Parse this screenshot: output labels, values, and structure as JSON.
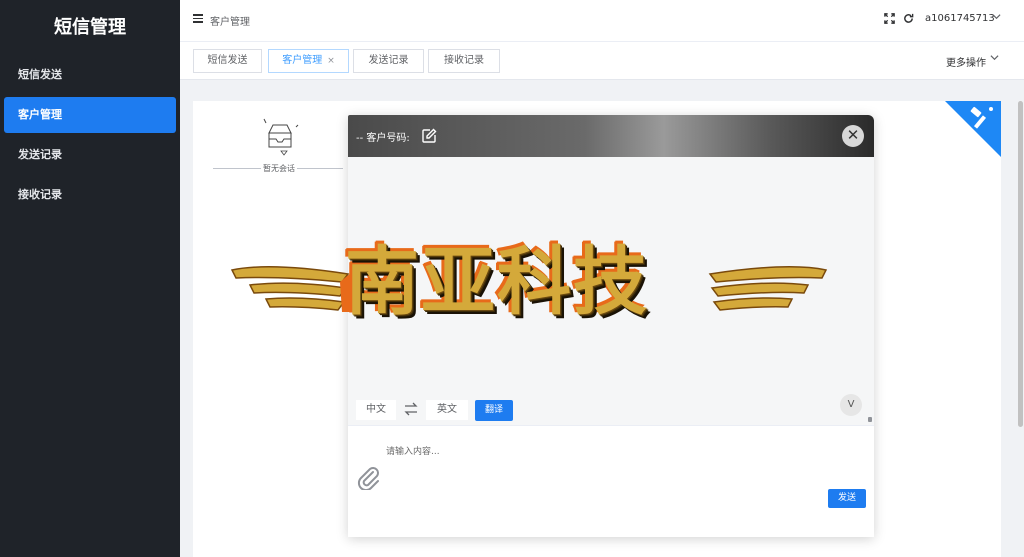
{
  "app": {
    "brand": "短信管理"
  },
  "sidebar": {
    "items": [
      {
        "label": "短信发送",
        "active": false
      },
      {
        "label": "客户管理",
        "active": true
      },
      {
        "label": "发送记录",
        "active": false
      },
      {
        "label": "接收记录",
        "active": false
      }
    ]
  },
  "header": {
    "breadcrumb": "客户管理",
    "user": "a1061745713"
  },
  "tabs": {
    "items": [
      {
        "label": "短信发送"
      },
      {
        "label": "客户管理",
        "close": "×"
      },
      {
        "label": "发送记录"
      },
      {
        "label": "接收记录"
      }
    ],
    "more_ops": "更多操作"
  },
  "content": {
    "empty_text": "暂无会话"
  },
  "dialog": {
    "title": "-- 客户号码:",
    "close": "✕",
    "v_badge": "V",
    "source_lang": "中文",
    "target_lang": "英文",
    "translate_label": "翻译",
    "input_placeholder": "请输入内容...",
    "send_label": "发送"
  },
  "watermark": {
    "text": "南亚科技"
  },
  "colors": {
    "sidebar_bg": "#1f2329",
    "accent": "#1e7cf0",
    "badge": "#1e88f5"
  }
}
